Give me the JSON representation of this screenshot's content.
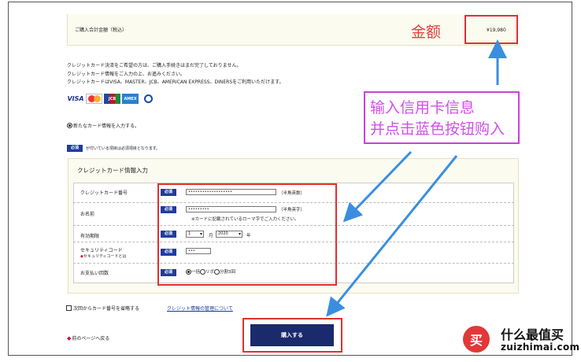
{
  "summary": {
    "total_label": "ご購入合計金額（税込）",
    "total_amount": "¥19,980"
  },
  "info_lines": [
    "クレジットカード決済をご希望の方は、ご購入手続きはまだ完了しておりません。",
    "クレジットカード情報をご入力の上、お進みください。",
    "クレジットカードはVISA、MASTER、JCB、AMERICAN EXPRESS、DINERSをご利用いただけます。"
  ],
  "card_brands": [
    "VISA",
    "MasterCard",
    "JCB",
    "AMEX",
    "Diners"
  ],
  "new_card_label": "新たなカード情報を入力する。",
  "required_badge": "必須",
  "required_note": "が付いている項目は必須項目となります。",
  "form": {
    "title": "クレジットカード情報入力",
    "card_number": {
      "label": "クレジットカード番号",
      "value": "•••••••••••••••••••",
      "hint": "（半角英数）"
    },
    "name": {
      "label": "お名前",
      "value": "•••••••••",
      "hint": "（半角英字）",
      "note": "※カードに記載されているローマ字でご入力ください。"
    },
    "expiry": {
      "label": "有効期限",
      "month": "1",
      "month_unit": "月",
      "year": "2020",
      "year_unit": "年"
    },
    "security": {
      "label": "セキュリティコード",
      "sublabel": "セキュリティコードとは",
      "value": "•••"
    },
    "payment": {
      "label": "お支払い回数",
      "options": [
        "一括",
        "リボ",
        "分割3回"
      ],
      "selected": "一括"
    }
  },
  "save_card_label": "次回からカード番号を省略する",
  "management_link": "クレジット情報の管理について",
  "back_link": "前のページへ戻る",
  "buy_button": "購入する",
  "annotations": {
    "amount": "金额",
    "instruction_line1": "输入信用卡信息",
    "instruction_line2": "并点击蓝色按钮购入"
  },
  "watermark": {
    "logo_text": "买",
    "site_name": "什么最值买",
    "site_url": "zuizhimai.com"
  },
  "colors": {
    "required_badge": "#1f3d9b",
    "buy_button": "#1a2a6c",
    "highlight_red": "#e03030",
    "annotation_magenta": "#cc3fe0",
    "arrow_blue": "#3a8ee0"
  }
}
